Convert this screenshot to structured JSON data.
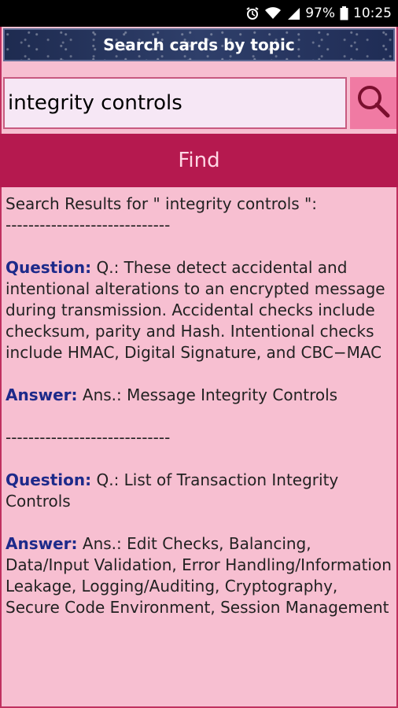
{
  "status": {
    "battery": "97%",
    "time": "10:25"
  },
  "header": {
    "title": "Search cards by topic"
  },
  "search": {
    "value": "integrity controls",
    "find_label": "Find"
  },
  "results": {
    "heading": "Search Results for \" integrity controls \":",
    "separator": "-----------------------------",
    "question_label": "Question:",
    "answer_label": "Answer:",
    "items": [
      {
        "question": "Q.: These detect accidental and intentional alterations to an encrypted message during transmission. Accidental checks include checksum, parity and Hash. Intentional checks include HMAC, Digital Signature, and CBC−MAC",
        "answer": "Ans.: Message Integrity Controls"
      },
      {
        "question": "Q.: List of Transaction Integrity Controls",
        "answer": "Ans.: Edit Checks, Balancing, Data/Input Validation, Error Handling/Information Leakage, Logging/Auditing, Cryptography, Secure Code Environment, Session Management"
      }
    ]
  },
  "icons": {
    "status": [
      "alarm-icon",
      "wifi-icon",
      "signal-icon",
      "battery-icon"
    ],
    "search": "search-icon"
  }
}
